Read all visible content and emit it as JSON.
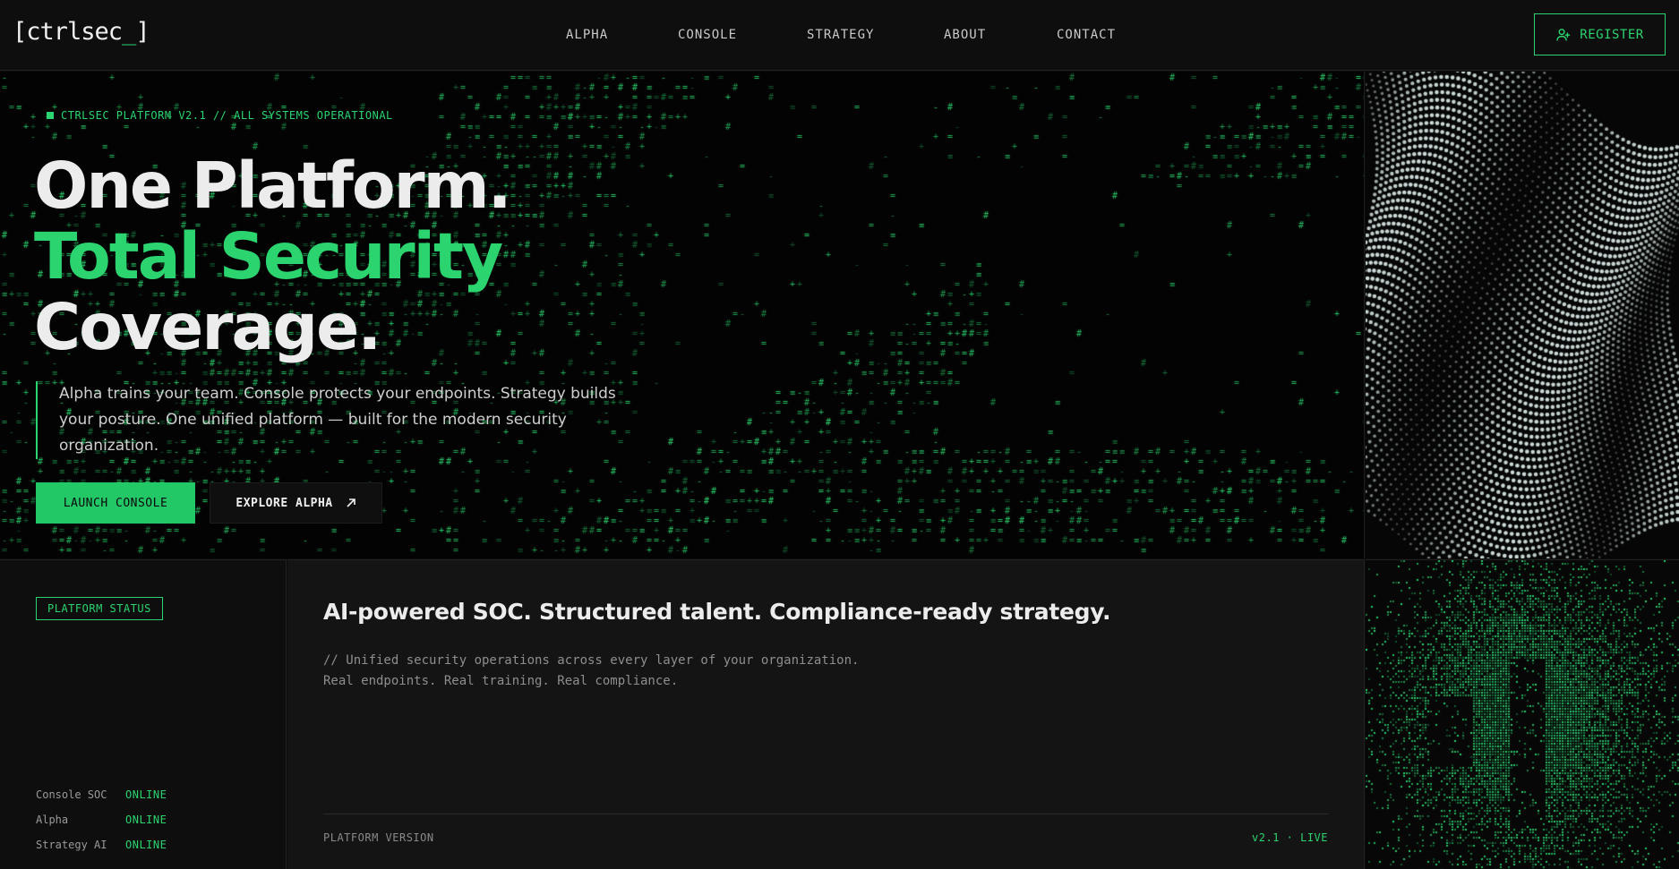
{
  "nav": {
    "logo": "[ctrlsec",
    "logo_cursor": "_",
    "logo_end": "]",
    "links": [
      "ALPHA",
      "CONSOLE",
      "STRATEGY",
      "ABOUT",
      "CONTACT"
    ],
    "register_label": "REGISTER"
  },
  "hero": {
    "tag": "CTRLSEC PLATFORM V2.1 // ALL SYSTEMS OPERATIONAL",
    "headline_1": "One Platform.",
    "headline_2": "Total Security",
    "headline_3": "Coverage.",
    "description": "Alpha trains your team. Console protects your endpoints. Strategy builds your posture. One unified platform — built for the modern security organization.",
    "primary_button": "LAUNCH CONSOLE",
    "secondary_button": "EXPLORE ALPHA"
  },
  "status": {
    "badge": "PLATFORM STATUS",
    "rows": [
      {
        "name": "Console SOC",
        "value": "ONLINE"
      },
      {
        "name": "Alpha",
        "value": "ONLINE"
      },
      {
        "name": "Strategy AI",
        "value": "ONLINE"
      }
    ]
  },
  "main": {
    "title": "AI-powered SOC. Structured talent. Compliance-ready strategy.",
    "subtitle_1": "// Unified security operations across every layer of your organization.",
    "subtitle_2": "Real endpoints. Real training. Real compliance.",
    "version_label": "PLATFORM VERSION",
    "version_value": "v2.1 · LIVE"
  },
  "colors": {
    "accent": "#2bd46f",
    "background": "#0b0b0b",
    "panel": "#141414"
  }
}
